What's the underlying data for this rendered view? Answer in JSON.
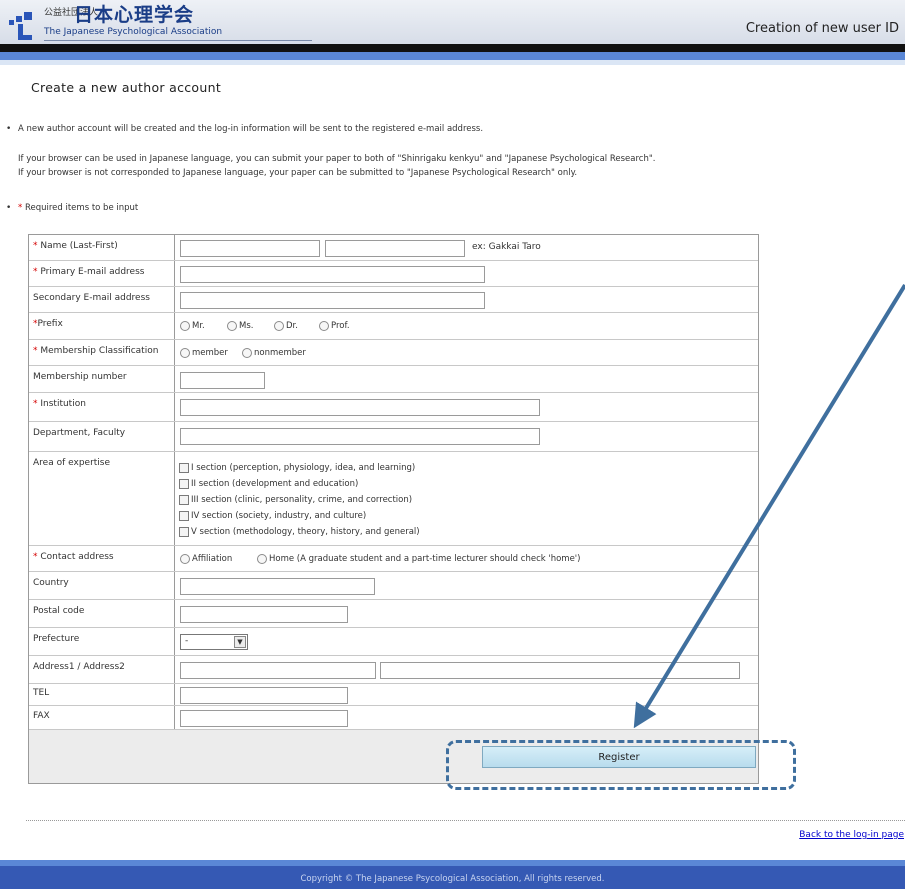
{
  "header": {
    "org_type": "公益社団法人",
    "org_name_jp": "日本心理学会",
    "org_name_en": "The Japanese Psychological Association",
    "page_title": "Creation of new user ID"
  },
  "main": {
    "heading": "Create a new author account",
    "note1": "A new author account will be created and the log-in information will be sent to the registered e-mail address.",
    "note2": "If your browser can be used in Japanese language, you can submit your paper to both of \"Shinrigaku kenkyu\" and \"Japanese Psychological Research\".",
    "note3": "If your browser is not corresponded to Japanese language, your paper can be submitted to \"Japanese Psychological Research\" only.",
    "required_star": "*",
    "required_note": "Required items to be input"
  },
  "form": {
    "name_label": "Name (Last-First)",
    "name_hint": "ex: Gakkai Taro",
    "primary_email_label": "Primary E-mail address",
    "secondary_email_label": "Secondary E-mail address",
    "prefix_label": "Prefix",
    "prefix_options": [
      "Mr.",
      "Ms.",
      "Dr.",
      "Prof."
    ],
    "membership_label": "Membership Classification",
    "membership_options": [
      "member",
      "nonmember"
    ],
    "membership_number_label": "Membership number",
    "institution_label": "Institution",
    "department_label": "Department, Faculty",
    "expertise_label": "Area of expertise",
    "expertise_options": [
      "I section (perception, physiology, idea, and learning)",
      "II section (development and education)",
      "III section (clinic, personality, crime, and correction)",
      "IV section (society, industry, and culture)",
      "V section (methodology, theory, history, and general)"
    ],
    "contact_label": "Contact address",
    "contact_options": [
      "Affiliation",
      "Home (A graduate student and a part-time lecturer should check 'home')"
    ],
    "country_label": "Country",
    "postal_label": "Postal code",
    "prefecture_label": "Prefecture",
    "prefecture_value": "-",
    "address_label": "Address1 / Address2",
    "tel_label": "TEL",
    "fax_label": "FAX",
    "register_label": "Register"
  },
  "footer": {
    "back_link": "Back to the log-in page",
    "copyright": "Copyright © The Japanese Psycological Association, All rights reserved."
  },
  "colors": {
    "accent_blue": "#5a87d6",
    "footer_blue": "#3559b4",
    "required_red": "#d40000",
    "annotation_blue": "#3f6f9e"
  }
}
